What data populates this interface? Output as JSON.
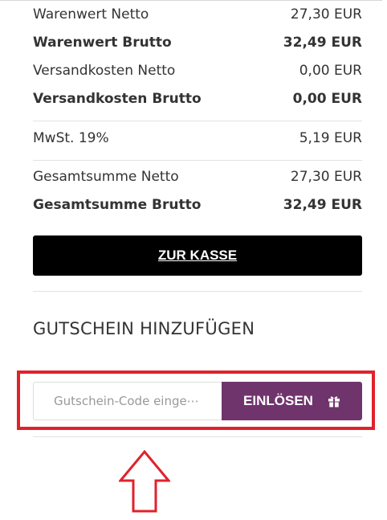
{
  "summary": {
    "goods_net_label": "Warenwert Netto",
    "goods_net_value": "27,30 EUR",
    "goods_gross_label": "Warenwert Brutto",
    "goods_gross_value": "32,49 EUR",
    "shipping_net_label": "Versandkosten Netto",
    "shipping_net_value": "0,00 EUR",
    "shipping_gross_label": "Versandkosten Brutto",
    "shipping_gross_value": "0,00 EUR",
    "vat_label": "MwSt. 19%",
    "vat_value": "5,19 EUR",
    "total_net_label": "Gesamtsumme Netto",
    "total_net_value": "27,30 EUR",
    "total_gross_label": "Gesamtsumme Brutto",
    "total_gross_value": "32,49 EUR"
  },
  "checkout": {
    "label": "ZUR KASSE"
  },
  "voucher": {
    "heading": "GUTSCHEIN HINZUFÜGEN",
    "input_placeholder": "Gutschein-Code einge⋯",
    "input_value": "",
    "redeem_label": "EINLÖSEN",
    "redeem_icon": "gift-icon"
  },
  "colors": {
    "checkout_button": "#000000",
    "redeem_button": "#70346d",
    "highlight": "#e0222b"
  }
}
